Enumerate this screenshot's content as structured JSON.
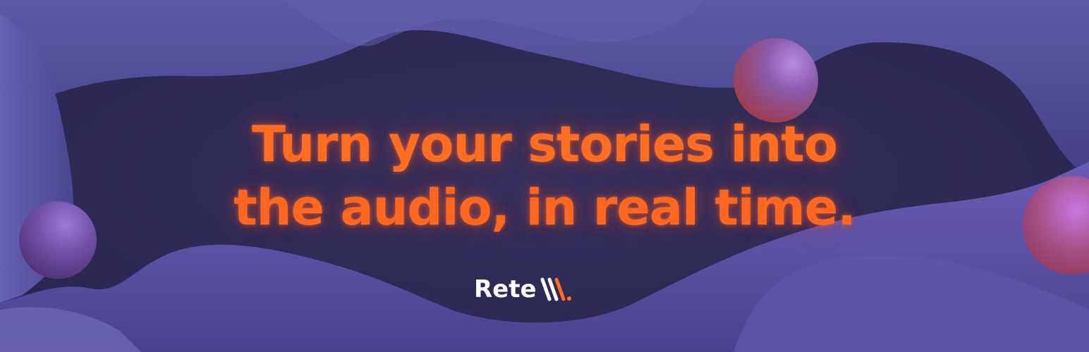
{
  "headline": {
    "line1": "Turn your stories into",
    "line2": "the audio, in real time."
  },
  "logo": {
    "wordmark": "Rete",
    "mark_icon": "triple-slash-orange-mark-icon"
  },
  "colors": {
    "background": "#2c2852",
    "blob": "#5a55a0",
    "blob_dark": "#3e3a78",
    "accent_orange": "#ff6a1f",
    "sphere_purple": "#8b6fd0",
    "sphere_red": "#b04a6a"
  }
}
